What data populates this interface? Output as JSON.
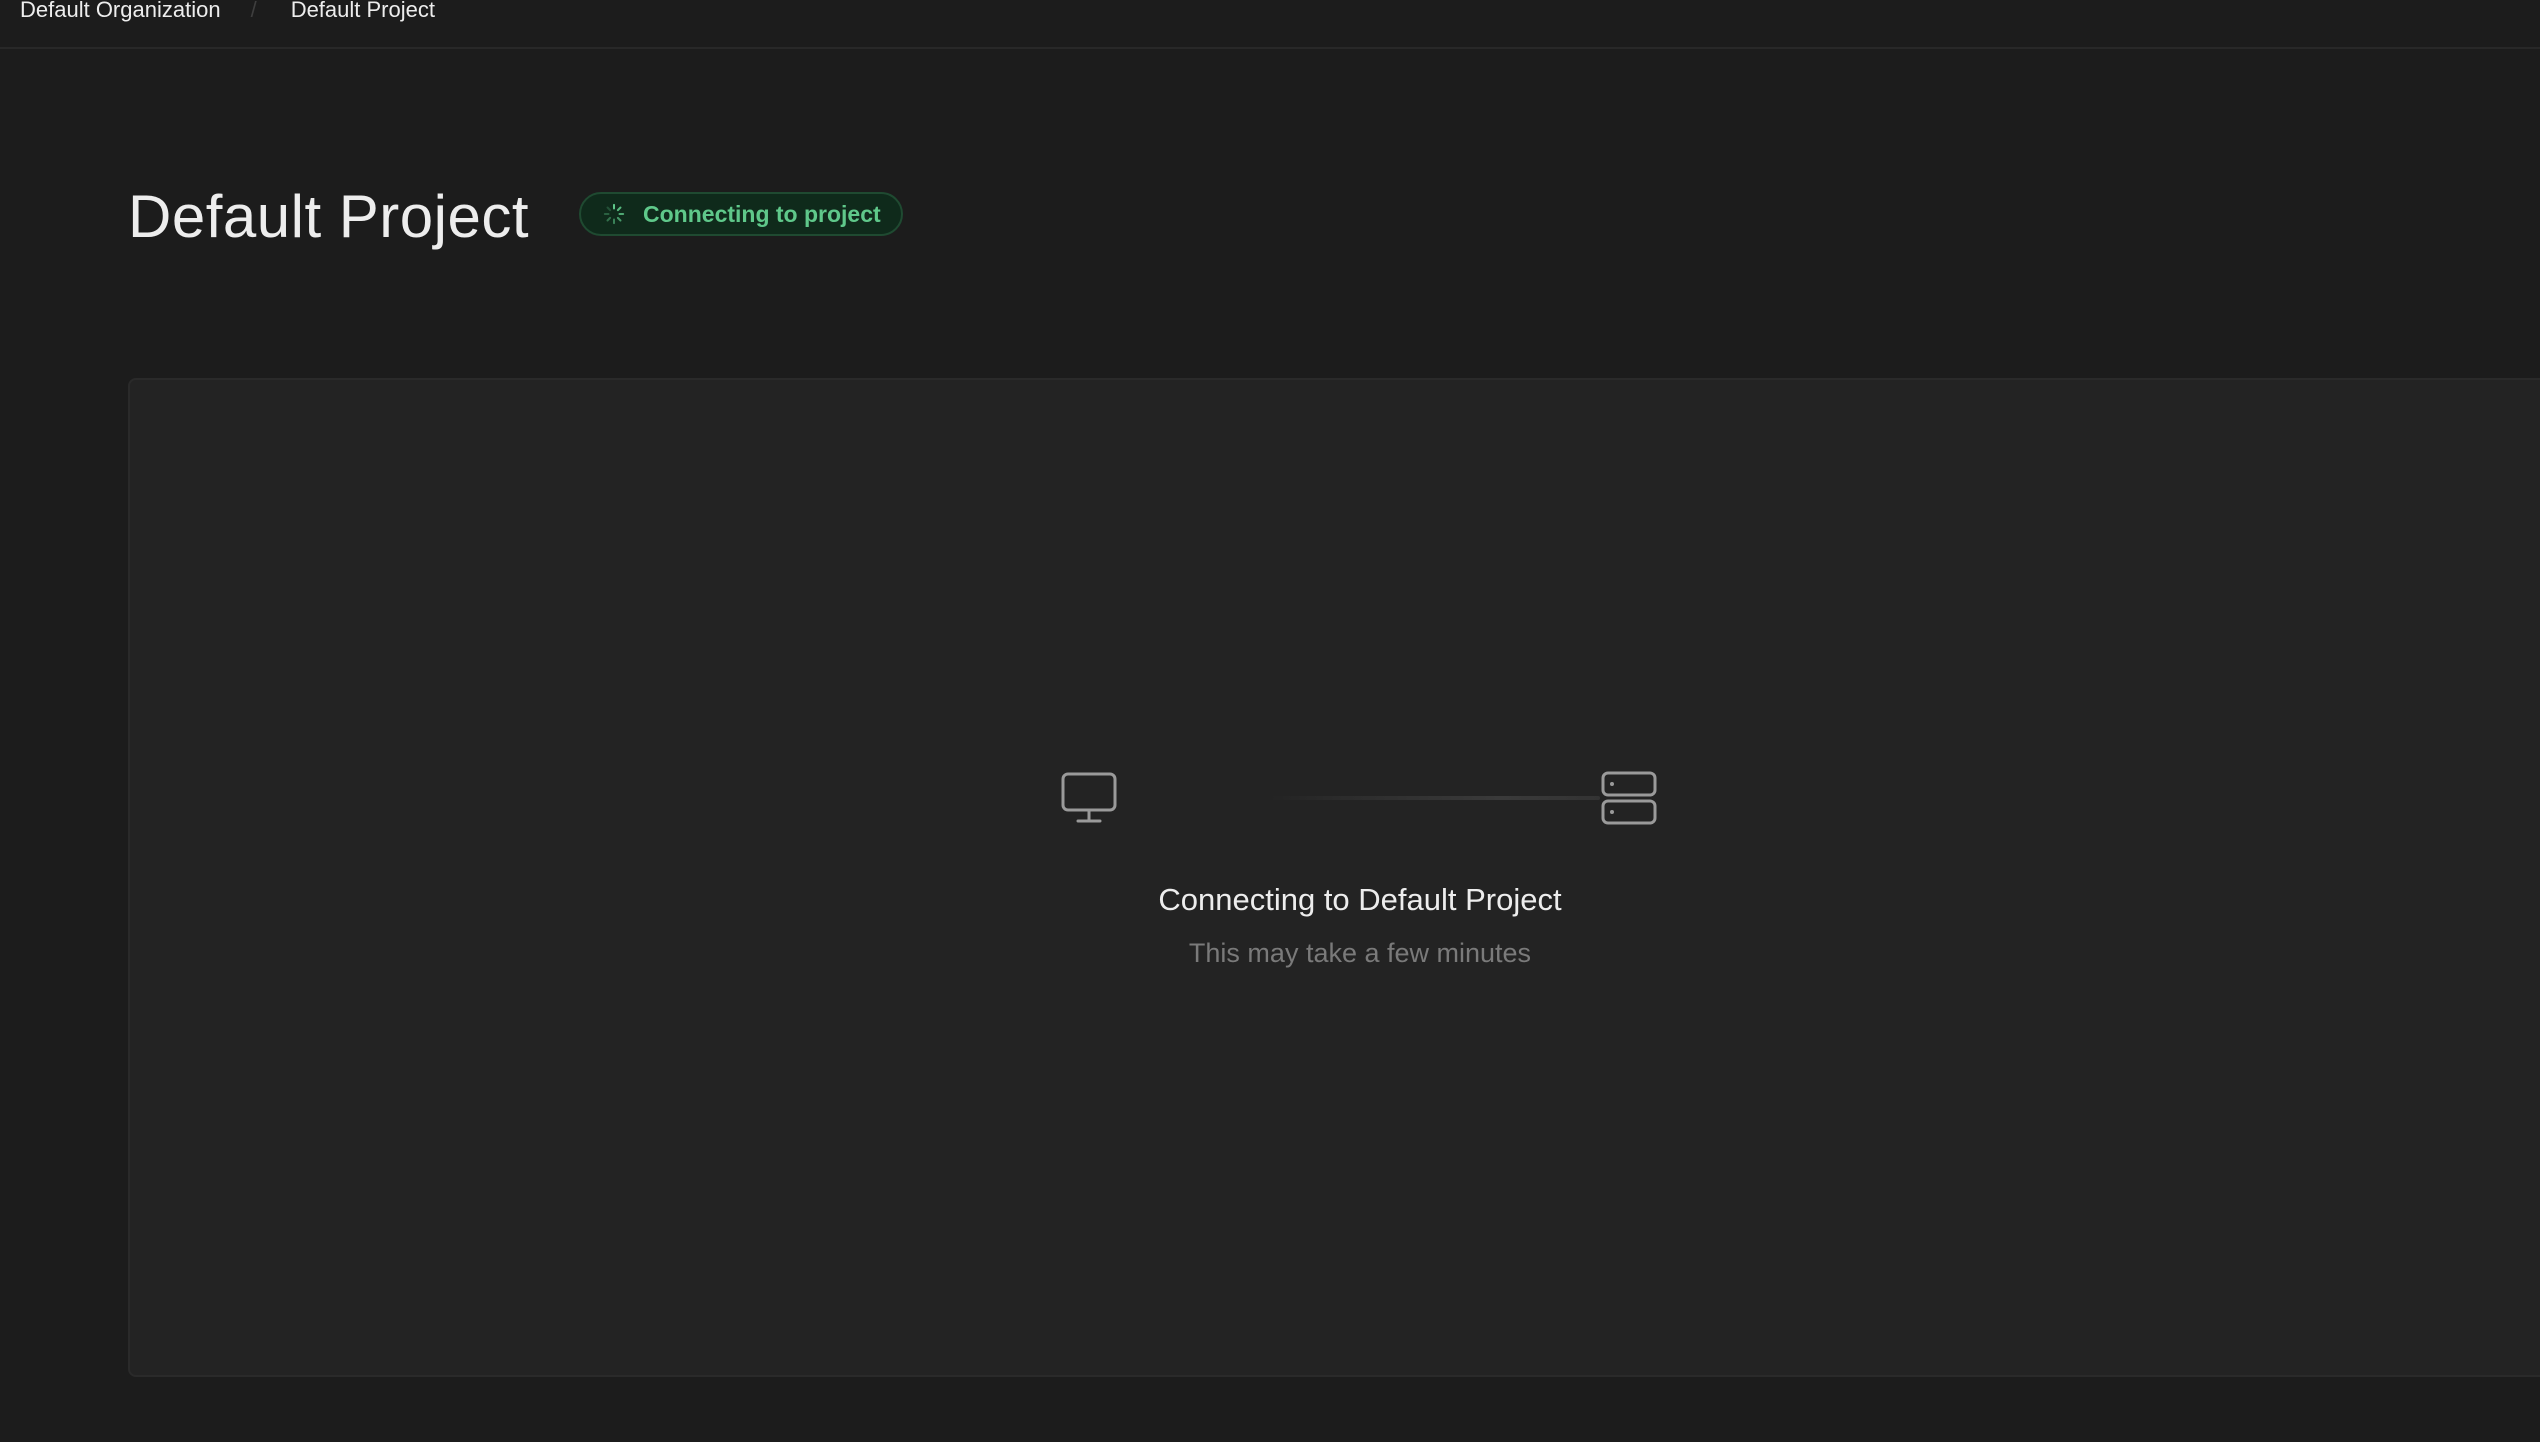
{
  "breadcrumb": {
    "organization": "Default Organization",
    "separator": "/",
    "project": "Default Project"
  },
  "header": {
    "title": "Default Project",
    "status_badge": "Connecting to project"
  },
  "connection": {
    "title": "Connecting to Default Project",
    "subtitle": "This may take a few minutes"
  },
  "icons": {
    "spinner": "spinner-icon",
    "client": "monitor-icon",
    "server": "server-icon"
  },
  "colors": {
    "background": "#1c1c1c",
    "panel": "#232323",
    "accent_green": "#5fc88a",
    "badge_bg": "#0f2a1b",
    "badge_border": "#1f4a31",
    "muted_text": "#7a7a7a"
  }
}
